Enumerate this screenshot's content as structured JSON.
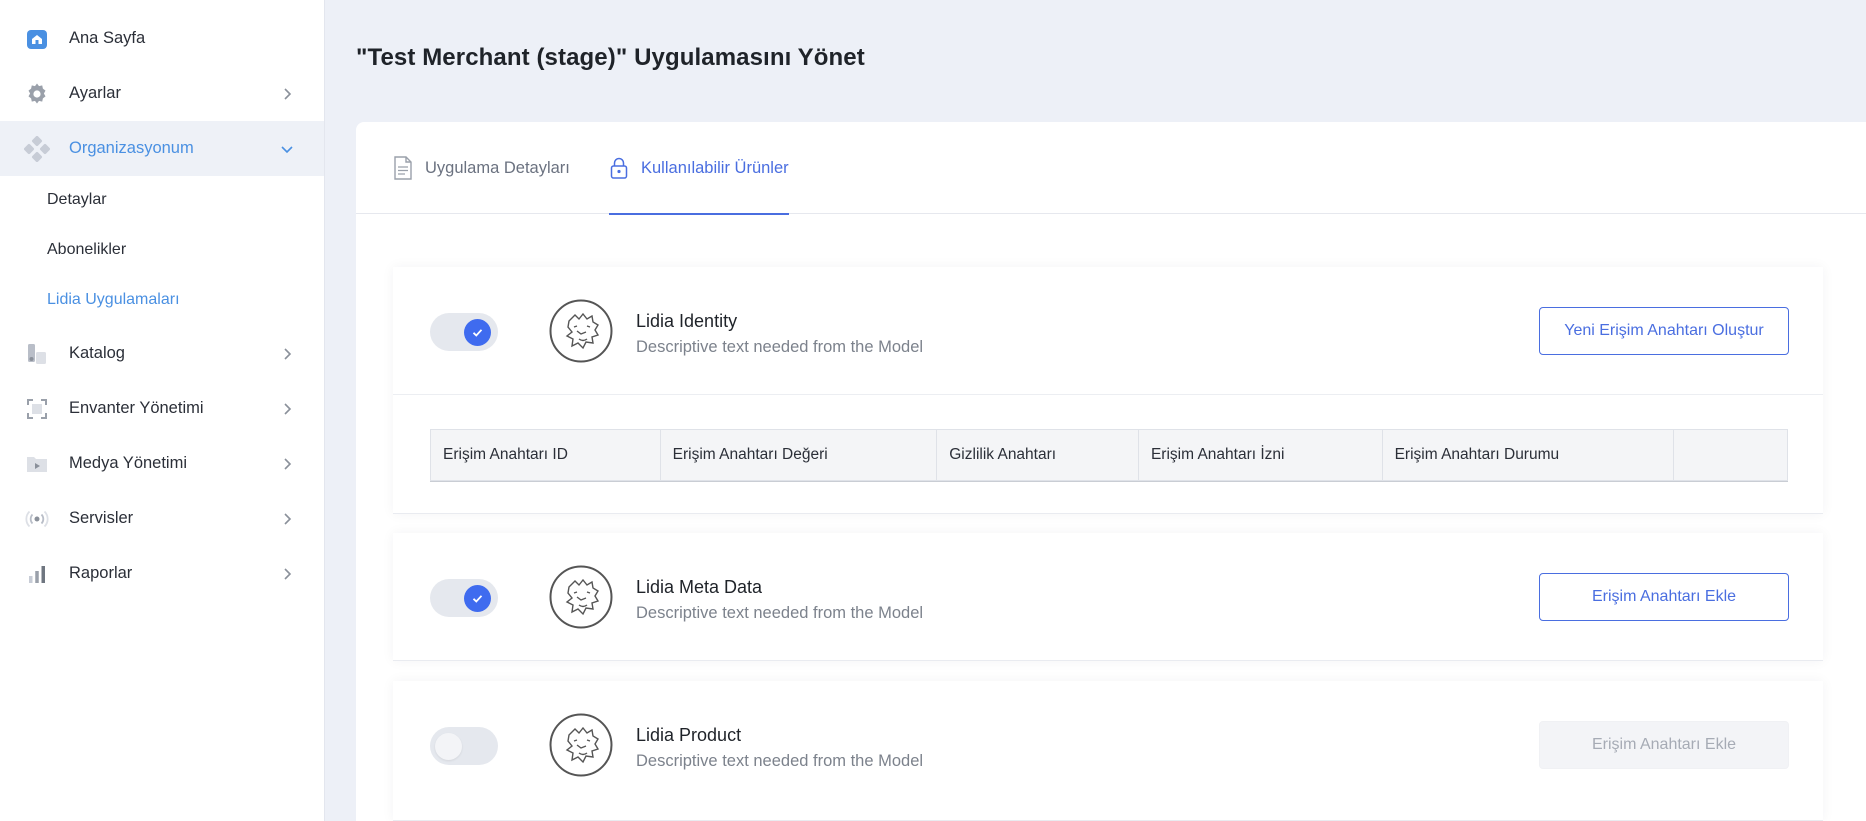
{
  "sidebar": {
    "items": [
      {
        "label": "Ana Sayfa",
        "icon": "home-icon"
      },
      {
        "label": "Ayarlar",
        "icon": "gear-icon"
      },
      {
        "label": "Organizasyonum",
        "icon": "organization-icon"
      },
      {
        "label": "Katalog",
        "icon": "catalog-icon"
      },
      {
        "label": "Envanter Yönetimi",
        "icon": "inventory-icon"
      },
      {
        "label": "Medya Yönetimi",
        "icon": "media-icon"
      },
      {
        "label": "Servisler",
        "icon": "services-icon"
      },
      {
        "label": "Raporlar",
        "icon": "reports-icon"
      }
    ],
    "subitems": [
      {
        "label": "Detaylar"
      },
      {
        "label": "Abonelikler"
      },
      {
        "label": "Lidia Uygulamaları"
      }
    ]
  },
  "page": {
    "title": "\"Test Merchant (stage)\" Uygulamasını Yönet"
  },
  "tabs": [
    {
      "label": "Uygulama Detayları",
      "icon": "document-icon"
    },
    {
      "label": "Kullanılabilir Ürünler",
      "icon": "lock-icon"
    }
  ],
  "products": [
    {
      "name": "Lidia Identity",
      "description": "Descriptive text needed from the Model",
      "enabled": true,
      "button_label": "Yeni Erişim Anahtarı Oluştur"
    },
    {
      "name": "Lidia Meta Data",
      "description": "Descriptive text needed from the Model",
      "enabled": true,
      "button_label": "Erişim Anahtarı Ekle"
    },
    {
      "name": "Lidia Product",
      "description": "Descriptive text needed from the Model",
      "enabled": false,
      "button_label": "Erişim Anahtarı Ekle"
    }
  ],
  "keys_table": {
    "columns": [
      "Erişim Anahtarı ID",
      "Erişim Anahtarı Değeri",
      "Gizlilik Anahtarı",
      "Erişim Anahtarı İzni",
      "Erişim Anahtarı Durumu",
      ""
    ]
  },
  "colors": {
    "accent": "#4a6ee0",
    "active_nav": "#4a90e2",
    "toggle_on": "#3f6bef"
  }
}
